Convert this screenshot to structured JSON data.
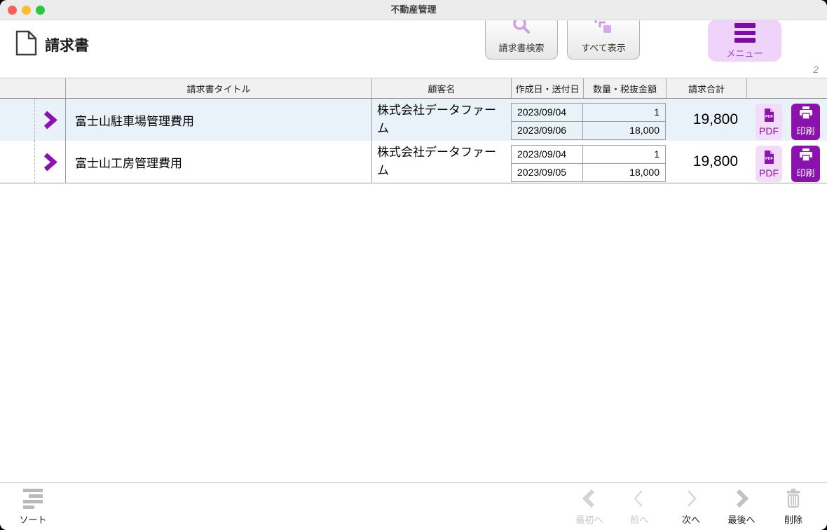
{
  "window": {
    "title": "不動産管理"
  },
  "header": {
    "page_title": "請求書",
    "search_button": "請求書検索",
    "show_all_button": "すべて表示",
    "menu_button": "メニュー",
    "record_count": "2"
  },
  "table": {
    "columns": {
      "title": "請求書タイトル",
      "customer": "顧客名",
      "dates": "作成日・送付日",
      "qty": "数量・税抜金額",
      "total": "請求合計"
    },
    "rows": [
      {
        "title": "富士山駐車場管理費用",
        "customer": "株式会社データファーム",
        "created_date": "2023/09/04",
        "sent_date": "2023/09/06",
        "quantity": "1",
        "amount": "18,000",
        "total": "19,800",
        "pdf_label": "PDF",
        "print_label": "印刷"
      },
      {
        "title": "富士山工房管理費用",
        "customer": "株式会社データファーム",
        "created_date": "2023/09/04",
        "sent_date": "2023/09/05",
        "quantity": "1",
        "amount": "18,000",
        "total": "19,800",
        "pdf_label": "PDF",
        "print_label": "印刷"
      }
    ]
  },
  "toolbar": {
    "sort": "ソート",
    "first": "最初へ",
    "prev": "前へ",
    "next": "次へ",
    "last": "最後へ",
    "delete": "削除"
  },
  "colors": {
    "accent_purple": "#8c12ae",
    "menu_lavender": "#efd3fb",
    "pdf_button_bg": "#f3dbfa",
    "selected_row": "#e9f1f9",
    "light_purple_icon": "#cf9cea",
    "traffic_red": "#ff5f57",
    "traffic_yellow": "#febc2e",
    "traffic_green": "#28c840"
  }
}
